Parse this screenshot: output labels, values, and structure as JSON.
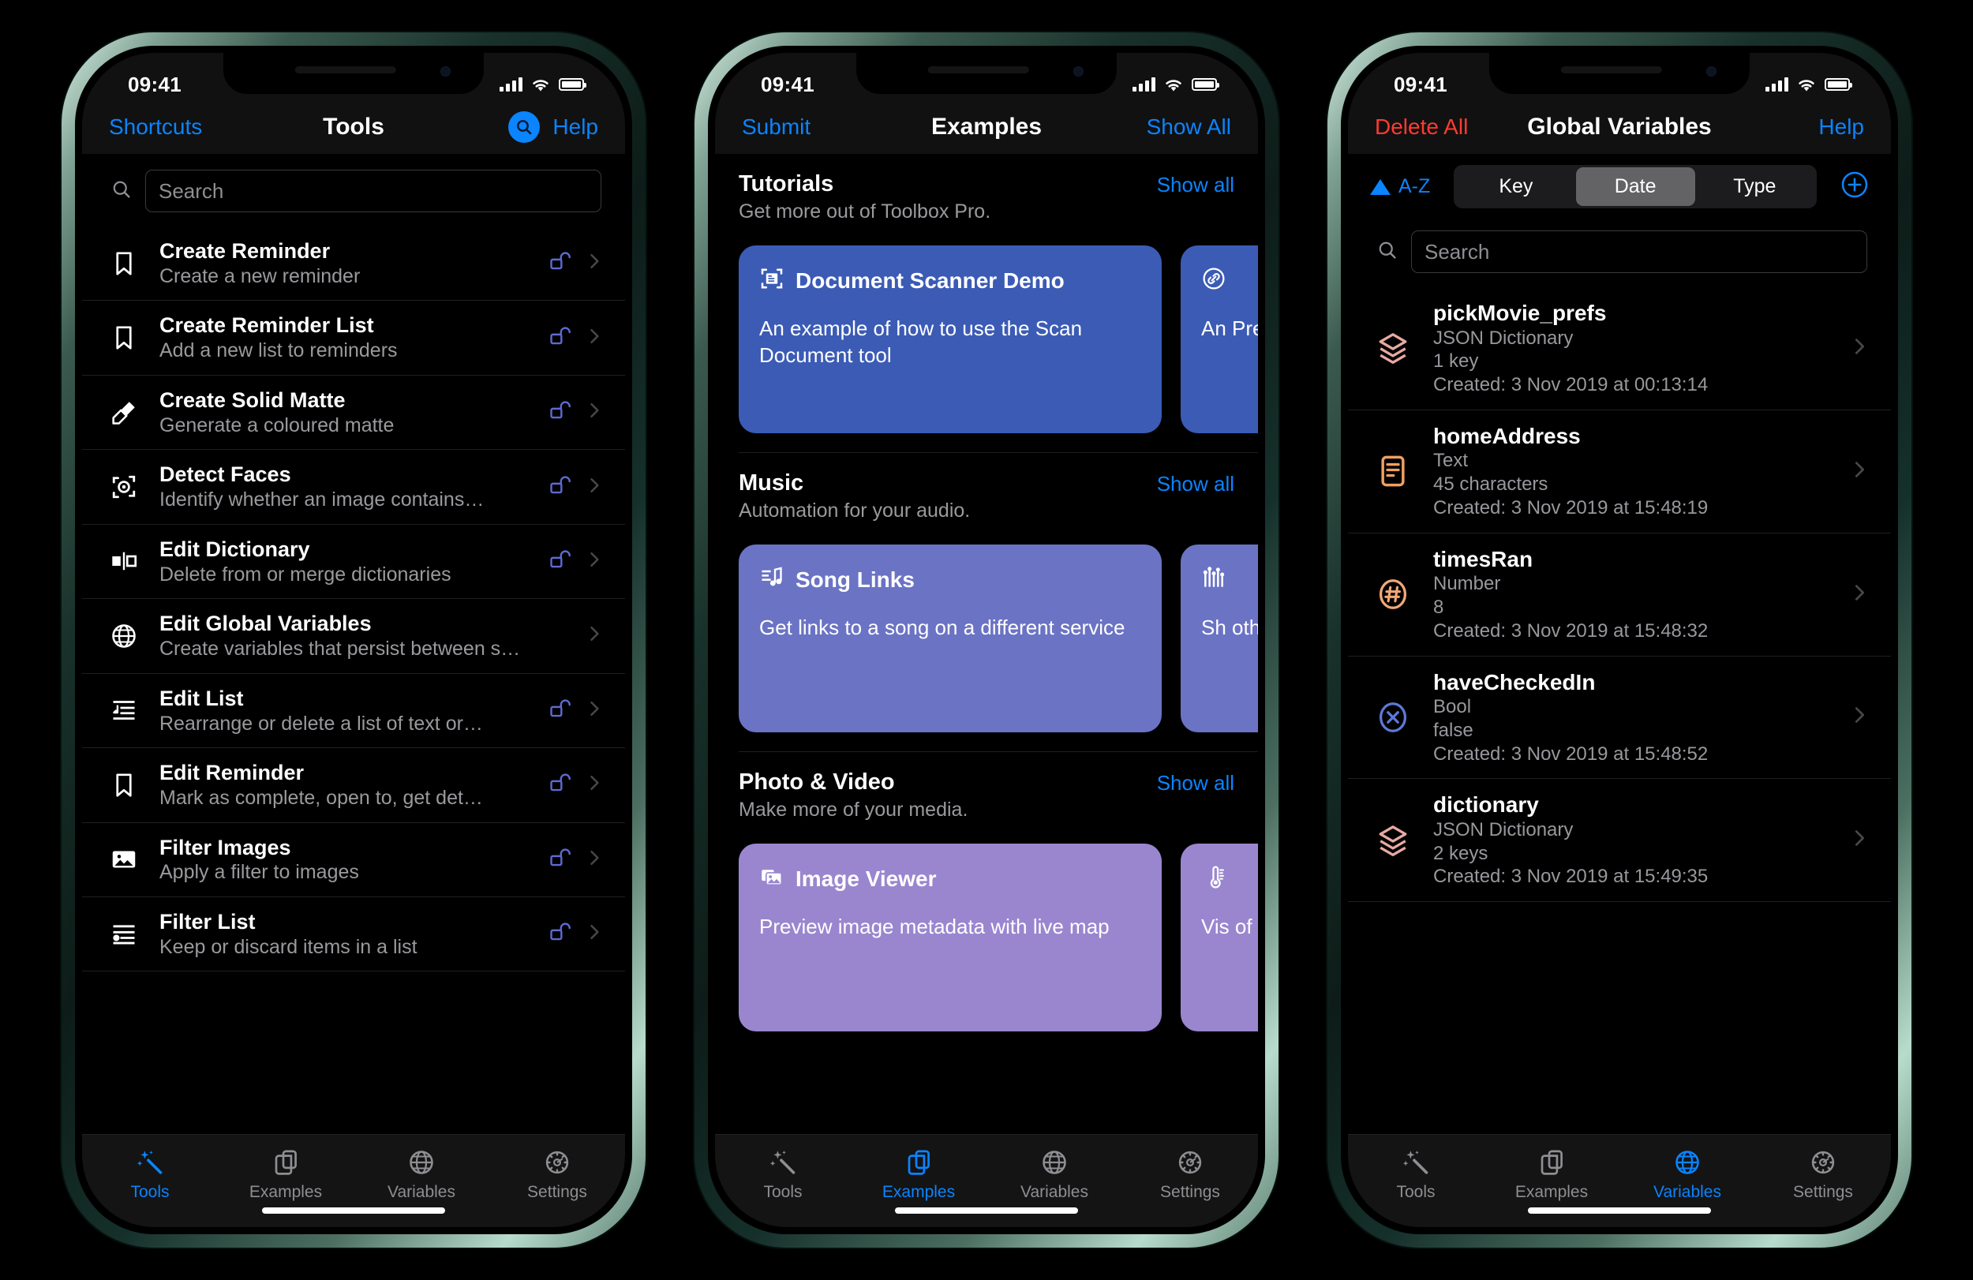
{
  "colors": {
    "accent_blue": "#0a84ff",
    "danger_red": "#ff3b30",
    "tutorial_card": "#3b5bb5",
    "music_card": "#6b73c4",
    "photo_card": "#9a86cf",
    "lock_icon": "#5e6ad2",
    "json_icon": "#e8a9a2",
    "text_icon": "#f0a060",
    "number_icon": "#f0a878",
    "bool_icon": "#5e78d8"
  },
  "status_bar": {
    "time": "09:41",
    "signal_icon": "cellular-bars-icon",
    "wifi_icon": "wifi-icon",
    "battery_icon": "battery-icon"
  },
  "phones": [
    {
      "id": "tools",
      "nav": {
        "left_label": "Shortcuts",
        "title": "Tools",
        "search_icon": "search-icon",
        "right_label": "Help"
      },
      "search": {
        "placeholder": "Search",
        "value": "",
        "icon": "search-icon"
      },
      "tools": [
        {
          "icon": "bookmark-icon",
          "title": "Create Reminder",
          "subtitle": "Create a new reminder",
          "lock": true
        },
        {
          "icon": "bookmark-icon",
          "title": "Create Reminder List",
          "subtitle": "Add a new list to reminders",
          "lock": true
        },
        {
          "icon": "paintbrush-icon",
          "title": "Create Solid Matte",
          "subtitle": "Generate a coloured matte",
          "lock": true
        },
        {
          "icon": "face-detect-icon",
          "title": "Detect Faces",
          "subtitle": "Identify whether an image contains…",
          "lock": true
        },
        {
          "icon": "dictionary-icon",
          "title": "Edit Dictionary",
          "subtitle": "Delete from or merge dictionaries",
          "lock": true
        },
        {
          "icon": "globe-icon",
          "title": "Edit Global Variables",
          "subtitle": "Create variables that persist between s…",
          "lock": false
        },
        {
          "icon": "list-rearrange-icon",
          "title": "Edit List",
          "subtitle": "Rearrange or delete a list of text or…",
          "lock": true
        },
        {
          "icon": "bookmark-icon",
          "title": "Edit Reminder",
          "subtitle": "Mark as complete, open to, get det…",
          "lock": true
        },
        {
          "icon": "photo-icon",
          "title": "Filter Images",
          "subtitle": "Apply a filter to images",
          "lock": true
        },
        {
          "icon": "filter-list-icon",
          "title": "Filter List",
          "subtitle": "Keep or discard items in a list",
          "lock": true
        }
      ],
      "tabs": [
        {
          "label": "Tools",
          "icon": "wand-sparkles-icon",
          "active": true
        },
        {
          "label": "Examples",
          "icon": "documents-icon",
          "active": false
        },
        {
          "label": "Variables",
          "icon": "globe-icon",
          "active": false
        },
        {
          "label": "Settings",
          "icon": "gear-icon",
          "active": false
        }
      ]
    },
    {
      "id": "examples",
      "nav": {
        "left_label": "Submit",
        "title": "Examples",
        "right_label": "Show All"
      },
      "sections": [
        {
          "title": "Tutorials",
          "subtitle": "Get more out of Toolbox Pro.",
          "show_all": "Show all",
          "card_color": "#3b5bb5",
          "cards": [
            {
              "icon": "doc-scanner-icon",
              "title": "Document Scanner Demo",
              "desc": "An example of how to use the Scan Document tool"
            },
            {
              "icon": "link-circle-icon",
              "title": "",
              "desc": "An Pre"
            }
          ]
        },
        {
          "title": "Music",
          "subtitle": "Automation for your audio.",
          "show_all": "Show all",
          "card_color": "#6b73c4",
          "cards": [
            {
              "icon": "music-list-icon",
              "title": "Song Links",
              "desc": "Get links to a song on a different service"
            },
            {
              "icon": "equalizer-icon",
              "title": "",
              "desc": "Sh oth"
            }
          ]
        },
        {
          "title": "Photo & Video",
          "subtitle": "Make more of your media.",
          "show_all": "Show all",
          "card_color": "#9a86cf",
          "cards": [
            {
              "icon": "image-stack-icon",
              "title": "Image Viewer",
              "desc": "Preview image metadata with live map"
            },
            {
              "icon": "thermometer-icon",
              "title": "",
              "desc": "Vis of"
            }
          ]
        }
      ],
      "tabs": [
        {
          "label": "Tools",
          "icon": "wand-sparkles-icon",
          "active": false
        },
        {
          "label": "Examples",
          "icon": "documents-icon",
          "active": true
        },
        {
          "label": "Variables",
          "icon": "globe-icon",
          "active": false
        },
        {
          "label": "Settings",
          "icon": "gear-icon",
          "active": false
        }
      ]
    },
    {
      "id": "variables",
      "nav": {
        "left_label": "Delete All",
        "title": "Global Variables",
        "right_label": "Help"
      },
      "sort": {
        "direction_icon": "triangle-up-icon",
        "direction_label": "A-Z",
        "segments": [
          {
            "label": "Key",
            "active": false
          },
          {
            "label": "Date",
            "active": true
          },
          {
            "label": "Type",
            "active": false
          }
        ],
        "add_icon": "plus-circle-icon"
      },
      "search": {
        "placeholder": "Search",
        "value": "",
        "icon": "search-icon"
      },
      "variables": [
        {
          "icon": "layers-icon",
          "icon_color": "#e8a9a2",
          "key": "pickMovie_prefs",
          "type": "JSON Dictionary",
          "value": "1 key",
          "created": "Created: 3 Nov 2019 at 00:13:14"
        },
        {
          "icon": "text-doc-icon",
          "icon_color": "#f0a060",
          "key": "homeAddress",
          "type": "Text",
          "value": "45 characters",
          "created": "Created: 3 Nov 2019 at 15:48:19"
        },
        {
          "icon": "hash-circle-icon",
          "icon_color": "#f0a878",
          "key": "timesRan",
          "type": "Number",
          "value": "8",
          "created": "Created: 3 Nov 2019 at 15:48:32"
        },
        {
          "icon": "x-circle-icon",
          "icon_color": "#5e78d8",
          "key": "haveCheckedIn",
          "type": "Bool",
          "value": "false",
          "created": "Created: 3 Nov 2019 at 15:48:52"
        },
        {
          "icon": "layers-icon",
          "icon_color": "#e8a9a2",
          "key": "dictionary",
          "type": "JSON Dictionary",
          "value": "2 keys",
          "created": "Created: 3 Nov 2019 at 15:49:35"
        }
      ],
      "tabs": [
        {
          "label": "Tools",
          "icon": "wand-sparkles-icon",
          "active": false
        },
        {
          "label": "Examples",
          "icon": "documents-icon",
          "active": false
        },
        {
          "label": "Variables",
          "icon": "globe-icon",
          "active": true
        },
        {
          "label": "Settings",
          "icon": "gear-icon",
          "active": false
        }
      ]
    }
  ]
}
